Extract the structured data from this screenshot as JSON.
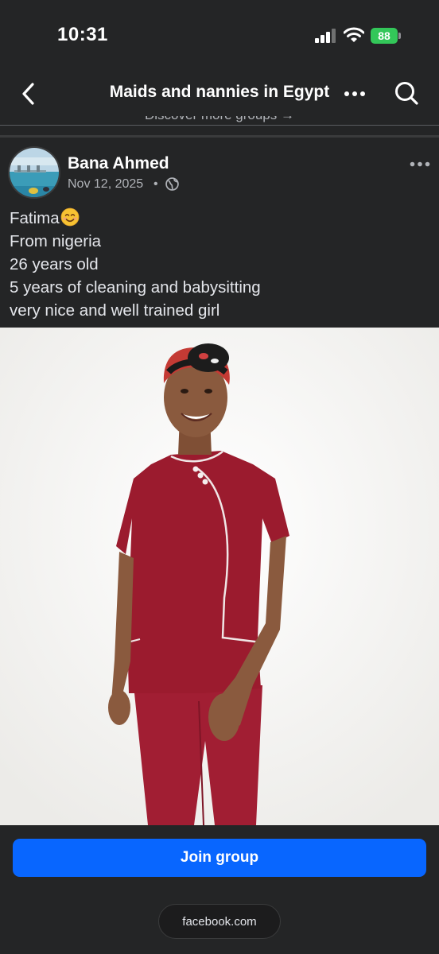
{
  "status_bar": {
    "time": "10:31",
    "battery_level": "88"
  },
  "header": {
    "title": "Maids and nannies in Egypt",
    "back_icon": "chevron-left-icon",
    "more_icon": "more-horizontal-icon",
    "search_icon": "search-icon"
  },
  "discover": {
    "label": "Discover more groups →"
  },
  "post": {
    "author": "Bana Ahmed",
    "date": "Nov 12, 2025",
    "separator": "•",
    "privacy_icon": "globe-icon",
    "lines": [
      "Fatima",
      "From nigeria",
      "26 years old",
      "5 years of cleaning and babysitting",
      "very nice and well trained girl"
    ]
  },
  "footer": {
    "join_label": "Join group",
    "url": "facebook.com"
  },
  "colors": {
    "background": "#242526",
    "primary_blue": "#0866ff",
    "battery_green": "#33c759",
    "secondary_text": "#b0b3b8",
    "uniform_red": "#9b1b2e"
  }
}
